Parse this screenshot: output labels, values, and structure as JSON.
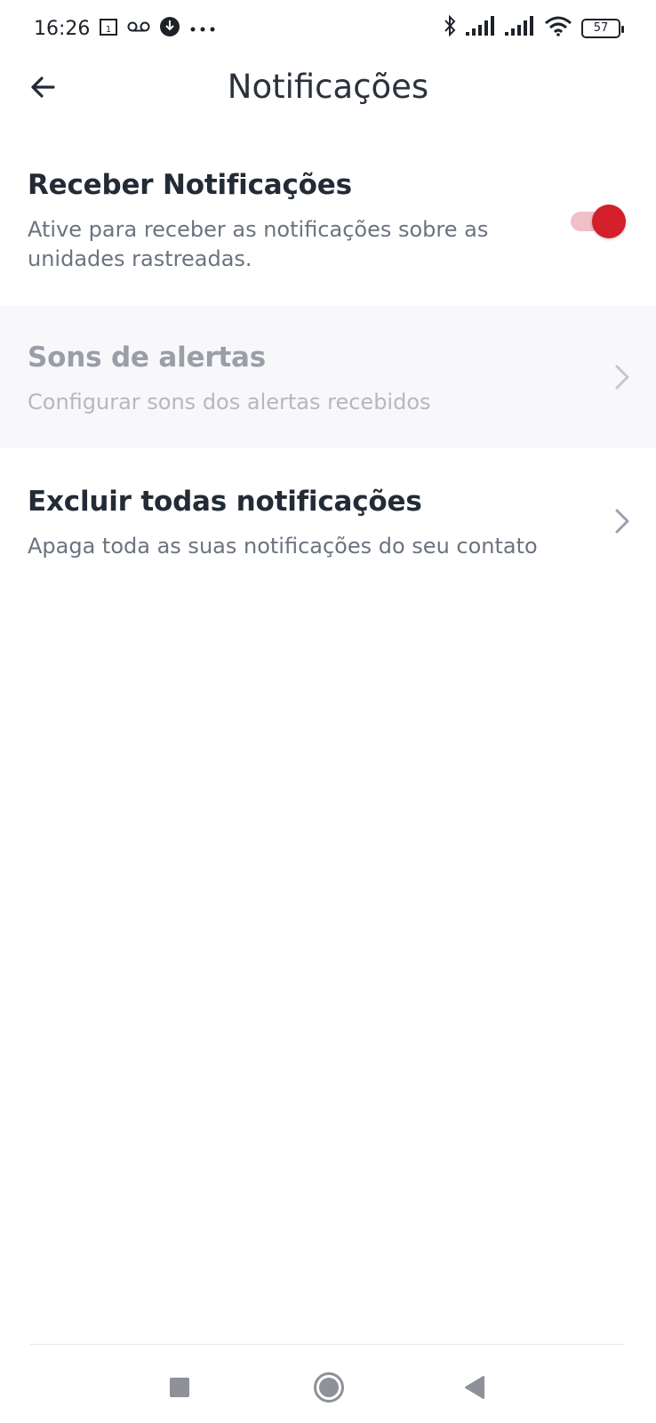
{
  "status_bar": {
    "time": "16:26",
    "battery": "57",
    "icons": [
      "calendar-icon",
      "voicemail-icon",
      "notification-icon",
      "more-icon",
      "bluetooth-icon",
      "signal-icon",
      "signal-icon",
      "wifi-icon",
      "battery-icon"
    ]
  },
  "header": {
    "title": "Notificações",
    "back_icon": "arrow-left-icon"
  },
  "settings": {
    "receive": {
      "title": "Receber Notificações",
      "description": "Ative para receber as notificações sobre as unidades rastreadas.",
      "enabled": true
    },
    "sounds": {
      "title": "Sons de alertas",
      "description": "Configurar sons dos alertas recebidos",
      "disabled": true
    },
    "delete_all": {
      "title": "Excluir todas notificações",
      "description": "Apaga toda as suas notificações do seu contato"
    }
  },
  "navigation": {
    "icons": [
      "square-icon",
      "circle-home-icon",
      "triangle-back-icon"
    ]
  },
  "colors": {
    "accent": "#d4202b",
    "accent_track": "#f0c0c6",
    "title_text": "#222b36",
    "secondary_text": "#6b7380",
    "disabled_bg": "#f8f8fa"
  }
}
